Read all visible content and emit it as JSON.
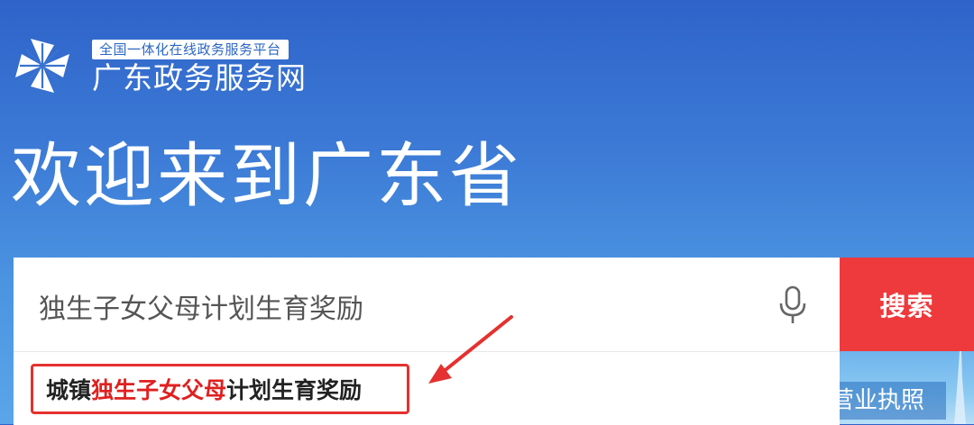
{
  "header": {
    "subtitle": "全国一体化在线政务服务平台",
    "site_name": "广东政务服务网",
    "logo_icon": "pinwheel-logo-icon"
  },
  "hero": {
    "welcome": "欢迎来到广东省"
  },
  "search": {
    "value": "独生子女父母计划生育奖励",
    "mic_icon": "microphone-icon",
    "button_label": "搜索"
  },
  "suggestions": [
    {
      "prefix": "城镇",
      "highlight": "独生子女父母",
      "suffix": "计划生育奖励"
    }
  ],
  "side_link": {
    "label": "营业执照"
  },
  "colors": {
    "brand_blue": "#2f63c9",
    "search_button": "#ee3a3c",
    "highlight_red": "#e02020",
    "annotation_red": "#e5312f"
  }
}
